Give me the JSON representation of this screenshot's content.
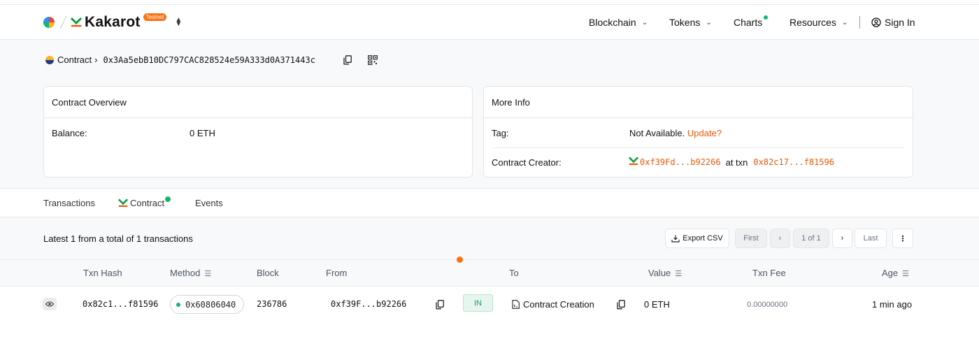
{
  "header": {
    "brand_name": "Kakarot",
    "network_badge": "Testnet",
    "nav": {
      "blockchain": "Blockchain",
      "tokens": "Tokens",
      "charts": "Charts",
      "resources": "Resources",
      "sign_in": "Sign In"
    }
  },
  "breadcrumb": {
    "label": "Contract",
    "address": "0x3Aa5ebB10DC797CAC828524e59A333d0A371443c"
  },
  "overview": {
    "title": "Contract Overview",
    "balance_label": "Balance:",
    "balance_value": "0 ETH"
  },
  "more_info": {
    "title": "More Info",
    "tag_label": "Tag:",
    "tag_value": "Not Available.",
    "tag_update": "Update?",
    "creator_label": "Contract Creator:",
    "creator_address": "0xf39Fd...b92266",
    "at_txn": "at txn",
    "creator_txn": "0x82c17...f81596"
  },
  "tabs": {
    "transactions": "Transactions",
    "contract": "Contract",
    "events": "Events"
  },
  "table": {
    "summary": "Latest 1 from a total of 1 transactions",
    "export_label": "Export CSV",
    "pagination": {
      "first": "First",
      "page_indicator": "1 of 1",
      "last": "Last"
    },
    "columns": {
      "txn_hash": "Txn Hash",
      "method": "Method",
      "block": "Block",
      "from": "From",
      "to": "To",
      "value": "Value",
      "txn_fee": "Txn Fee",
      "age": "Age"
    },
    "rows": [
      {
        "txn_hash": "0x82c1...f81596",
        "method": "0x60806040",
        "block": "236786",
        "from": "0xf39F...b92266",
        "direction": "IN",
        "to": "Contract Creation",
        "value": "0 ETH",
        "txn_fee": "0.00000000",
        "age": "1 min ago"
      }
    ]
  },
  "colors": {
    "accent": "#e8590c",
    "success": "#12b76a",
    "brand_green": "#0e9f3e"
  }
}
